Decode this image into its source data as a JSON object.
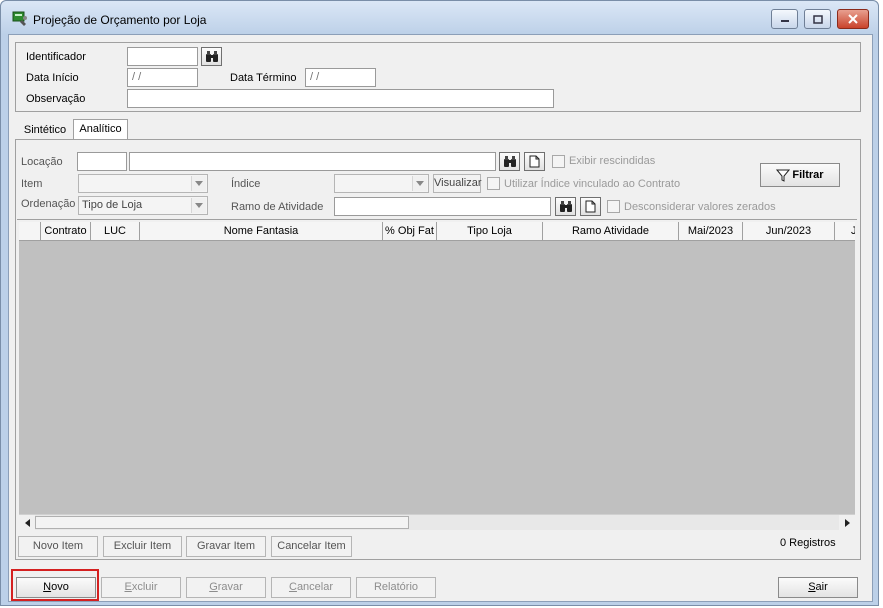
{
  "window": {
    "title": "Projeção de Orçamento por Loja",
    "accent": "#bcd0e8"
  },
  "header": {
    "identificador_label": "Identificador",
    "identificador_value": "",
    "data_inicio_label": "Data Início",
    "data_inicio_value": "/ /",
    "data_termino_label": "Data Término",
    "data_termino_value": "/ /",
    "observacao_label": "Observação",
    "observacao_value": ""
  },
  "tabs": [
    {
      "label": "Sintético",
      "active": false
    },
    {
      "label": "Analítico",
      "active": true
    }
  ],
  "filters": {
    "locacao_label": "Locação",
    "exibir_rescindidas_label": "Exibir rescindidas",
    "item_label": "Item",
    "indice_label": "Índice",
    "visualizar_label": "Visualizar",
    "utilizar_indice_label": "Utilizar Índice vinculado ao Contrato",
    "ordenacao_label": "Ordenação",
    "ordenacao_value": "Tipo de Loja",
    "ramo_atividade_label": "Ramo de Atividade",
    "desconsiderar_label": "Desconsiderar valores zerados",
    "filtrar_label": "Filtrar"
  },
  "grid": {
    "columns": [
      "Contrato",
      "LUC",
      "Nome Fantasia",
      "% Obj Fat",
      "Tipo Loja",
      "Ramo Atividade",
      "Mai/2023",
      "Jun/2023",
      "J"
    ],
    "rows": []
  },
  "item_buttons": {
    "novo_item": "Novo Item",
    "excluir_item": "Excluir Item",
    "gravar_item": "Gravar Item",
    "cancelar_item": "Cancelar Item",
    "registros": "0 Registros"
  },
  "footer": {
    "novo_first": "N",
    "novo_rest": "ovo",
    "excluir_first": "E",
    "excluir_rest": "xcluir",
    "gravar_first": "G",
    "gravar_rest": "ravar",
    "cancelar_first": "C",
    "cancelar_rest": "ancelar",
    "relatorio": "Relatório",
    "sair_first": "S",
    "sair_rest": "air",
    "highlight_color": "#d42020"
  }
}
